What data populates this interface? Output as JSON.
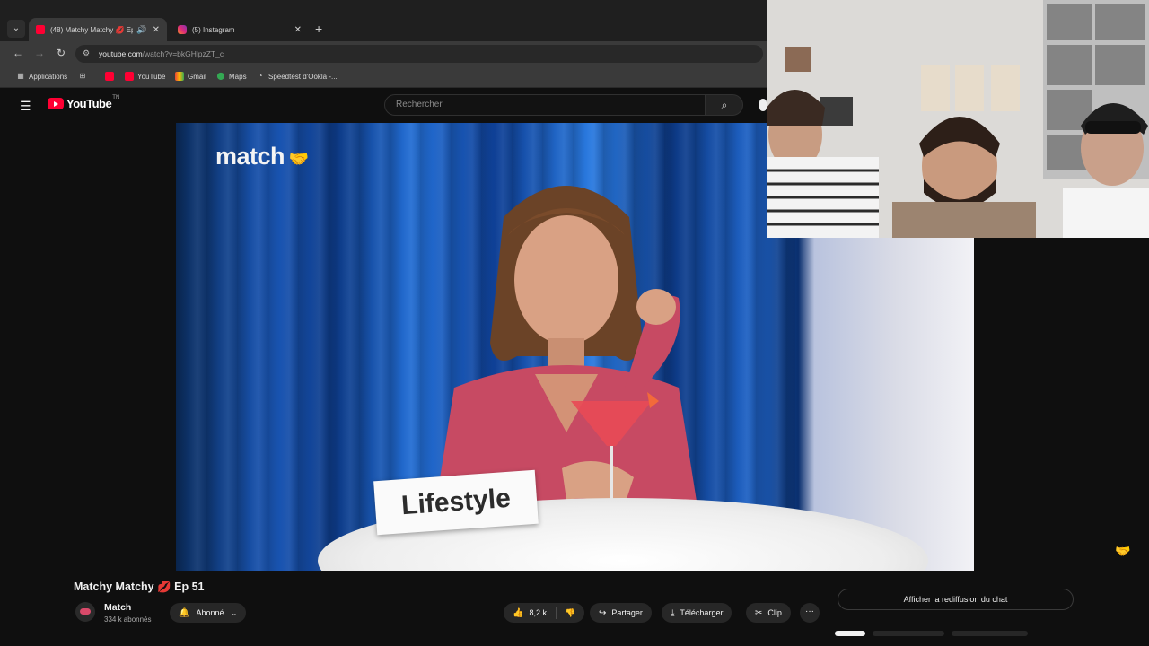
{
  "browser": {
    "tabs": [
      {
        "title": "(48) Matchy Matchy 💋 Ep",
        "active": true,
        "icon": "youtube-favicon"
      },
      {
        "title": "(5) Instagram",
        "active": false,
        "icon": "instagram-favicon"
      }
    ],
    "url_host": "youtube.com",
    "url_rest": "/watch?v=bkGHlpzZT_c",
    "bookmarks": [
      "Applications",
      "YouTube",
      "Gmail",
      "Maps",
      "Speedtest d'Ookla -..."
    ]
  },
  "youtube": {
    "logo_text": "YouTube",
    "logo_tm": "TN",
    "search_placeholder": "Rechercher"
  },
  "video": {
    "brand_text": "match",
    "placard_text": "Lifestyle"
  },
  "below": {
    "title_pre": "Matchy Matchy",
    "title_emoji": "💋",
    "title_post": "Ep 51",
    "channel_name": "Match",
    "channel_subs": "334 k abonnés",
    "subscribe_label": "Abonné",
    "like_count": "8,2 k",
    "share_label": "Partager",
    "download_label": "Télécharger",
    "clip_label": "Clip",
    "more_label": "···",
    "chat_replay_label": "Afficher la rediffusion du chat"
  }
}
